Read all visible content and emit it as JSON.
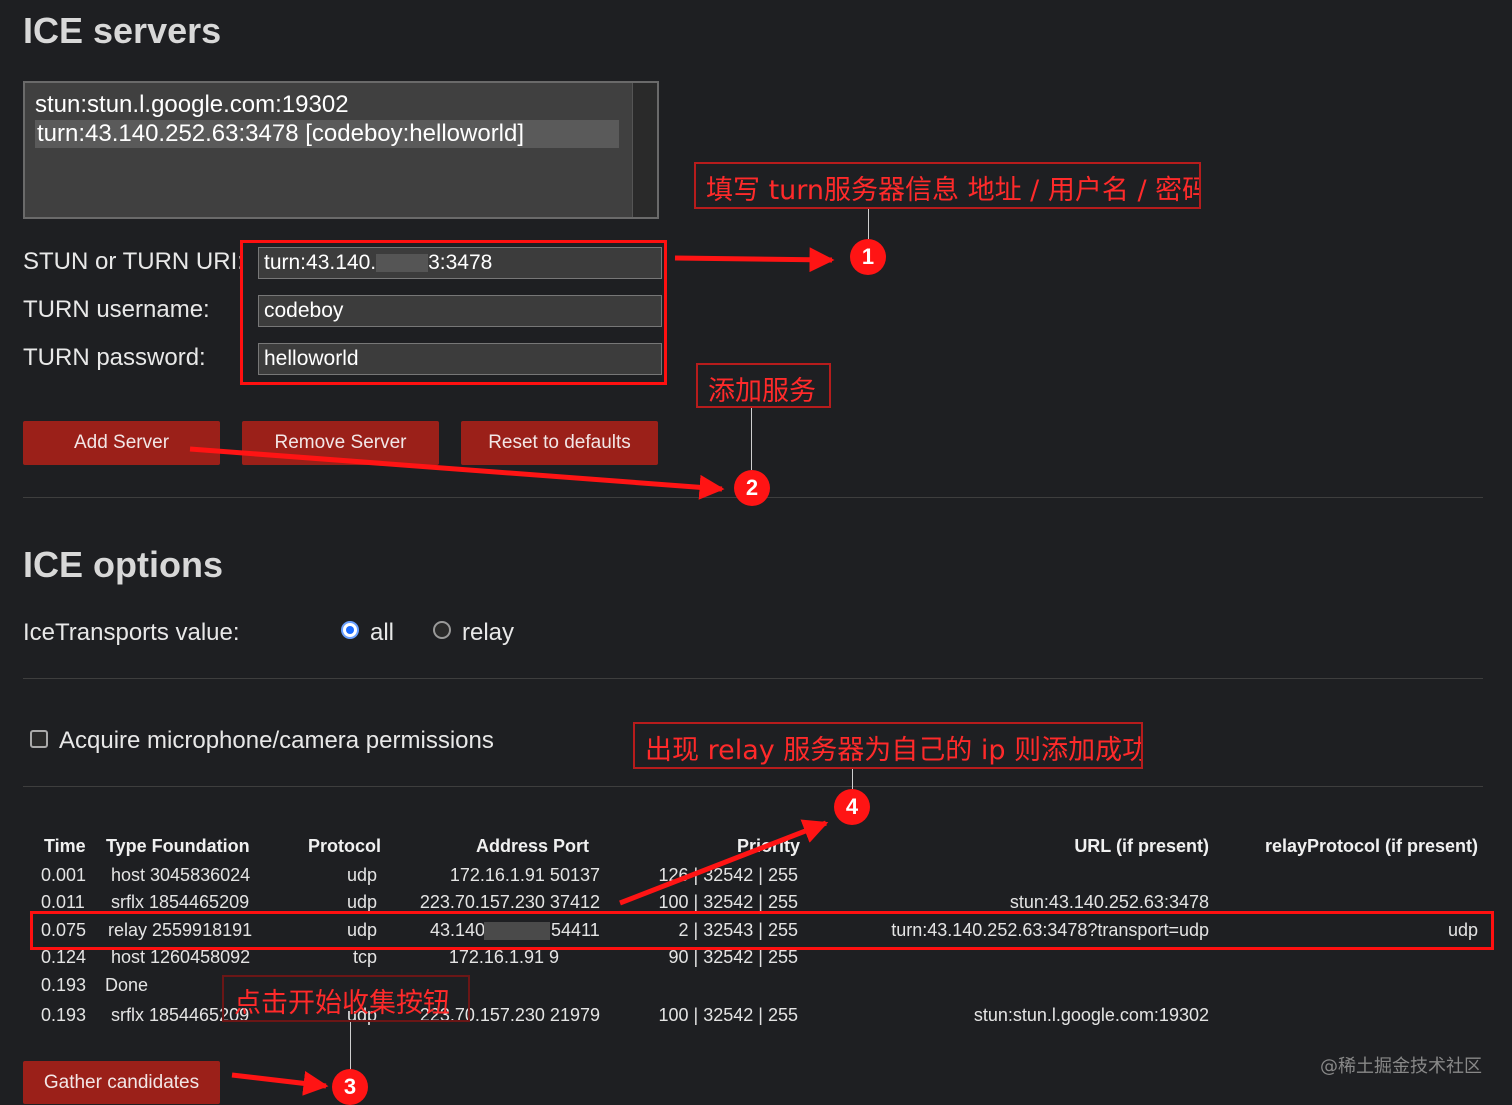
{
  "ice_servers": {
    "heading": "ICE servers",
    "list": [
      {
        "text": "stun:stun.l.google.com:19302",
        "selected": false
      },
      {
        "text": "turn:43.140.252.63:3478 [codeboy:helloworld]",
        "selected": true
      }
    ],
    "uri_label": "STUN or TURN URI:",
    "uri_value_prefix": "turn:43.140.",
    "uri_value_suffix": "3:3478",
    "username_label": "TURN username:",
    "username_value": "codeboy",
    "password_label": "TURN password:",
    "password_value": "helloworld",
    "buttons": {
      "add": "Add Server",
      "remove": "Remove Server",
      "reset": "Reset to defaults"
    }
  },
  "ice_options": {
    "heading": "ICE options",
    "transports_label": "IceTransports value:",
    "options": [
      {
        "label": "all",
        "checked": true
      },
      {
        "label": "relay",
        "checked": false
      }
    ],
    "acquire_label": "Acquire microphone/camera permissions",
    "acquire_checked": false
  },
  "candidates_table": {
    "headers": [
      "Time",
      "Type Foundation",
      "Protocol",
      "Address Port",
      "Priority",
      "URL (if present)",
      "relayProtocol (if present)"
    ],
    "rows": [
      {
        "time": "0.001",
        "type": "host 3045836024",
        "protocol": "udp",
        "address": "172.16.1.91 50137",
        "priority": "126 | 32542 | 255",
        "url": "",
        "relay": ""
      },
      {
        "time": "0.011",
        "type": "srflx 1854465209",
        "protocol": "udp",
        "address": "223.70.157.230 37412",
        "priority": "100 | 32542 | 255",
        "url": "stun:43.140.252.63:3478",
        "relay": ""
      },
      {
        "time": "0.075",
        "type": "relay 2559918191",
        "protocol": "udp",
        "address_prefix": "43.140",
        "address_suffix": "54411",
        "priority": "2 | 32543 | 255",
        "url": "turn:43.140.252.63:3478?transport=udp",
        "relay": "udp"
      },
      {
        "time": "0.124",
        "type": "host 1260458092",
        "protocol": "tcp",
        "address": "172.16.1.91 9",
        "priority": "90 | 32542 | 255",
        "url": "",
        "relay": ""
      },
      {
        "time": "0.193",
        "type": "Done",
        "protocol": "",
        "address": "",
        "priority": "",
        "url": "",
        "relay": ""
      },
      {
        "time": "0.193",
        "type": "srflx 1854465209",
        "protocol": "udp",
        "address": "223.70.157.230 21979",
        "priority": "100 | 32542 | 255",
        "url": "stun:stun.l.google.com:19302",
        "relay": ""
      }
    ]
  },
  "gather_button": "Gather candidates",
  "annotations": {
    "note1": "填写 turn服务器信息 地址 / 用户名 / 密码",
    "note2": "添加服务",
    "note3": "点击开始收集按钮",
    "note4": "出现 relay 服务器为自己的 ip 则添加成功",
    "badges": [
      "1",
      "2",
      "3",
      "4"
    ]
  },
  "watermark": "@稀土掘金技术社区",
  "colors": {
    "button": "#9b2019",
    "annotation_red": "#ff1414",
    "background": "#1e1f22"
  }
}
